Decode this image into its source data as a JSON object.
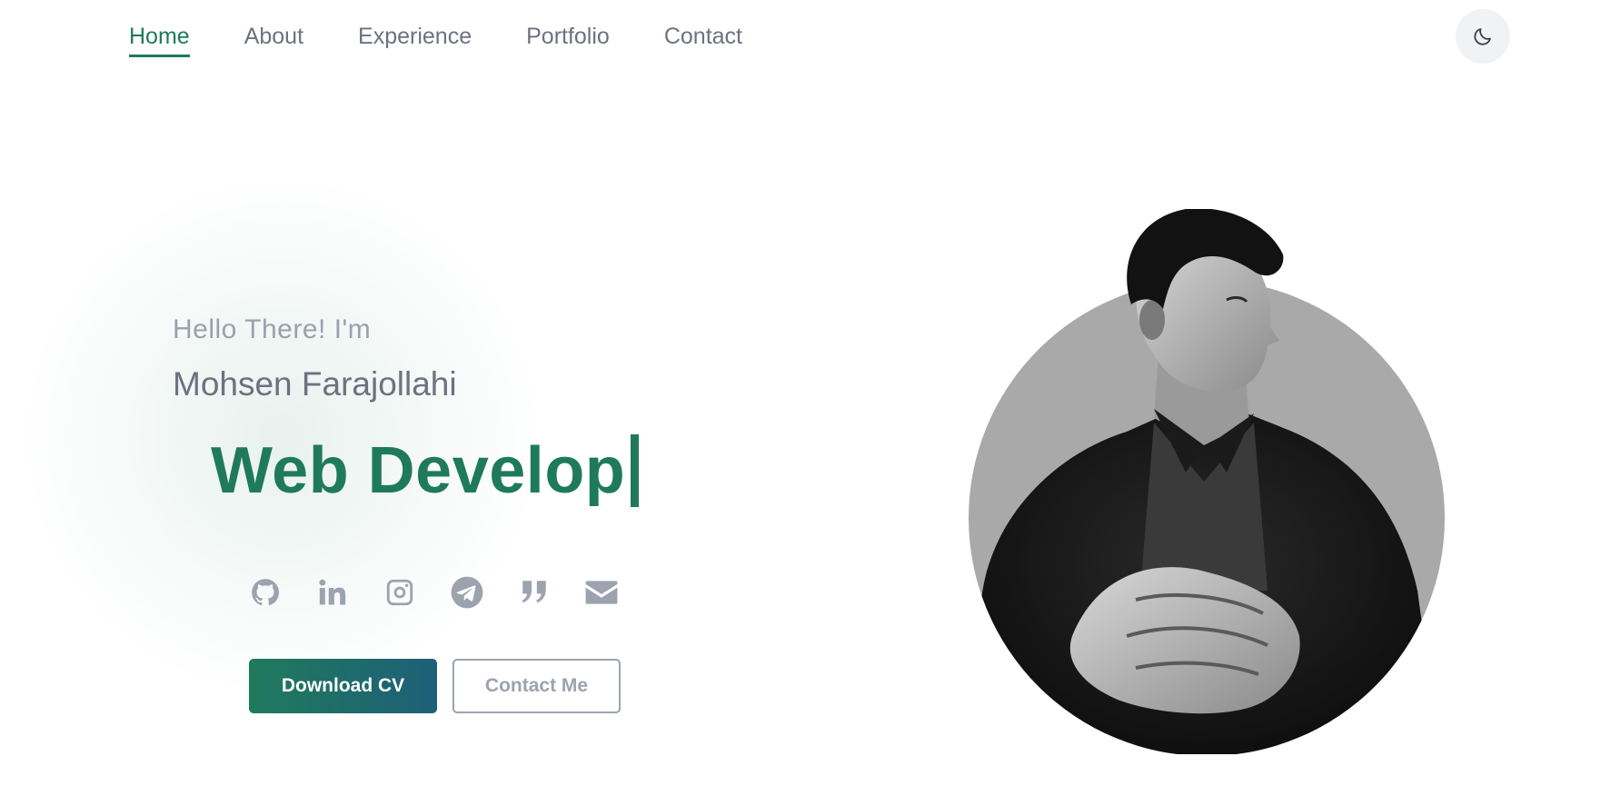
{
  "nav": {
    "items": [
      {
        "label": "Home",
        "active": true
      },
      {
        "label": "About",
        "active": false
      },
      {
        "label": "Experience",
        "active": false
      },
      {
        "label": "Portfolio",
        "active": false
      },
      {
        "label": "Contact",
        "active": false
      }
    ],
    "theme_toggle_icon": "moon-icon"
  },
  "hero": {
    "greeting": "Hello There! I'm",
    "name": "Mohsen Farajollahi",
    "role_typed": "Web Develop",
    "socials": [
      {
        "icon": "github-icon"
      },
      {
        "icon": "linkedin-icon"
      },
      {
        "icon": "instagram-icon"
      },
      {
        "icon": "telegram-icon"
      },
      {
        "icon": "quote-icon"
      },
      {
        "icon": "envelope-icon"
      }
    ],
    "buttons": {
      "download_cv": "Download CV",
      "contact_me": "Contact Me"
    },
    "portrait_icon": "portrait-image"
  },
  "colors": {
    "accent": "#1f7a5c",
    "accent_gradient_end": "#1e5f78",
    "muted_text": "#6b7280",
    "light_text": "#9aa1ad",
    "icon": "#9ca3af"
  }
}
